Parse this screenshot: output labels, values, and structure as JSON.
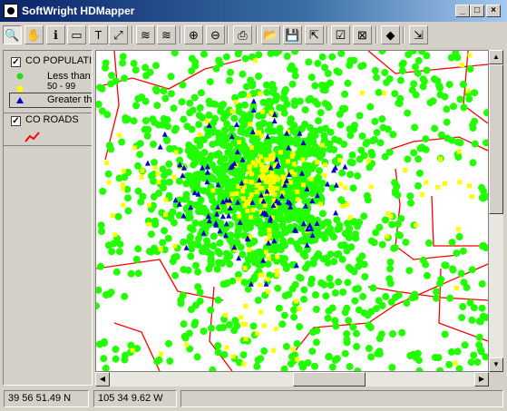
{
  "window": {
    "title": "SoftWright HDMapper"
  },
  "toolbar": {
    "buttons": [
      {
        "name": "zoom-tool-button",
        "glyph": "🔍"
      },
      {
        "name": "pan-tool-button",
        "glyph": "✋"
      },
      {
        "name": "info-tool-button",
        "glyph": "ℹ"
      },
      {
        "name": "label-tool-button",
        "glyph": "▭"
      },
      {
        "name": "text-tool-button",
        "glyph": "T"
      },
      {
        "name": "measure-tool-button",
        "glyph": "⤢"
      },
      {
        "name": "layers-button",
        "glyph": "≋"
      },
      {
        "name": "layers-edit-button",
        "glyph": "≋"
      },
      {
        "name": "zoom-in-button",
        "glyph": "⊕"
      },
      {
        "name": "zoom-out-button",
        "glyph": "⊖"
      },
      {
        "name": "print-button",
        "glyph": "⎙"
      },
      {
        "name": "open-button",
        "glyph": "📂"
      },
      {
        "name": "save-button",
        "glyph": "💾"
      },
      {
        "name": "export-button",
        "glyph": "⇱"
      },
      {
        "name": "properties-button",
        "glyph": "☑"
      },
      {
        "name": "delete-layer-button",
        "glyph": "⊠"
      },
      {
        "name": "add-layer-button",
        "glyph": "◆"
      },
      {
        "name": "help-button",
        "glyph": "⇲"
      }
    ]
  },
  "legend": {
    "layer1": {
      "name": "CO POPULATI",
      "checked": "✓",
      "items": [
        {
          "label": "Less than",
          "color": "#22dd22",
          "shape": "circle"
        },
        {
          "label": "50 - 99",
          "color": "#ffff00",
          "shape": "square"
        },
        {
          "label": "Greater th",
          "color": "#0000cc",
          "shape": "triangle"
        }
      ]
    },
    "layer2": {
      "name": "CO ROADS",
      "checked": "✓",
      "color": "#ff0000"
    }
  },
  "status": {
    "lat": "39 56 51.49 N",
    "lon": "105 34 9.62 W"
  },
  "map": {
    "point_color": "#22ff00",
    "urban_color": "#ffff00",
    "high_color": "#0000cc",
    "road_color": "#ff0000"
  }
}
